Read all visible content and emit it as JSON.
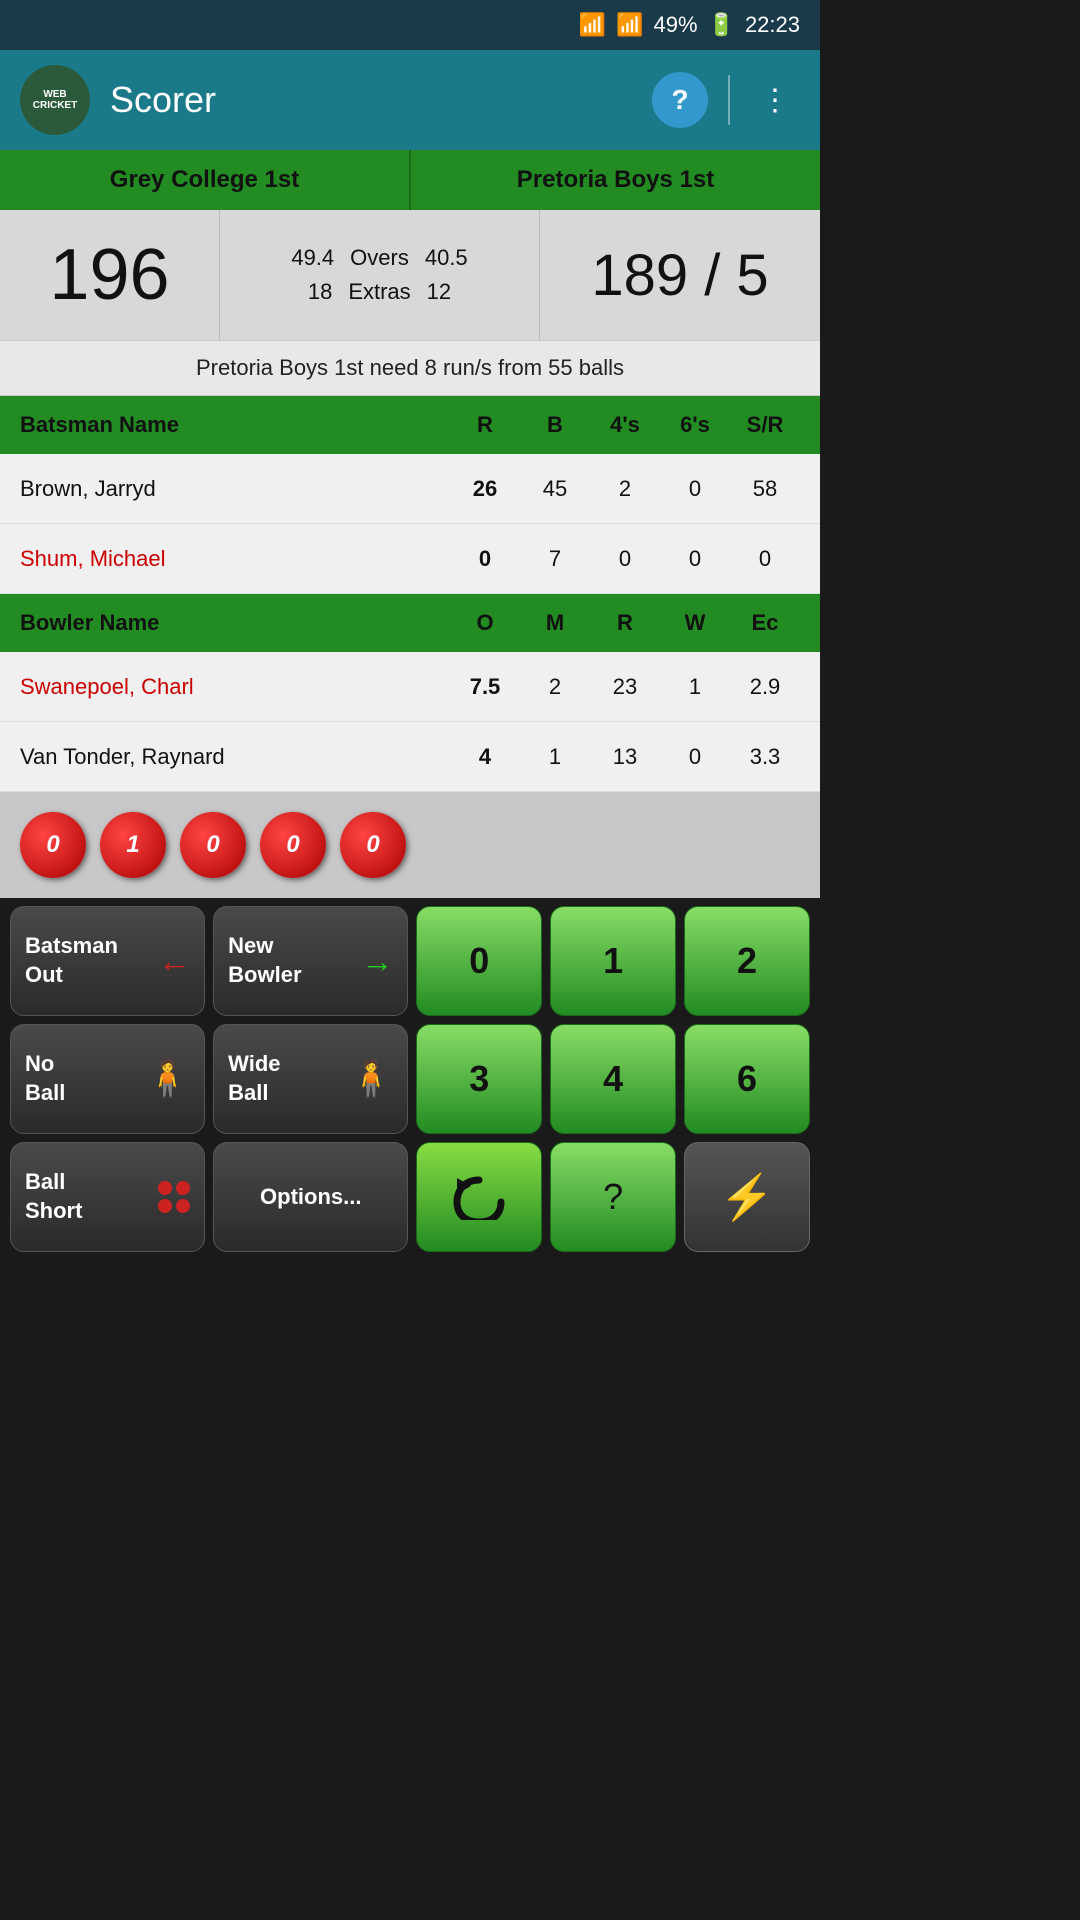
{
  "statusBar": {
    "battery": "49%",
    "time": "22:23"
  },
  "header": {
    "title": "Scorer",
    "helpLabel": "?"
  },
  "teams": {
    "team1": "Grey College 1st",
    "team2": "Pretoria Boys 1st"
  },
  "scores": {
    "team1Score": "196",
    "team1Overs": "49.4",
    "team1Extras": "18",
    "oversLabel": "Overs",
    "extrasLabel": "Extras",
    "team2Overs": "40.5",
    "team2Extras": "12",
    "team2Score": "189 / 5"
  },
  "infoBar": {
    "text": "Pretoria Boys 1st need 8 run/s from 55 balls"
  },
  "batsmanTable": {
    "headers": {
      "name": "Batsman Name",
      "r": "R",
      "b": "B",
      "fours": "4's",
      "sixes": "6's",
      "sr": "S/R"
    },
    "rows": [
      {
        "name": "Brown, Jarryd",
        "r": "26",
        "b": "45",
        "fours": "2",
        "sixes": "0",
        "sr": "58",
        "active": false
      },
      {
        "name": "Shum, Michael",
        "r": "0",
        "b": "7",
        "fours": "0",
        "sixes": "0",
        "sr": "0",
        "active": true
      }
    ]
  },
  "bowlerTable": {
    "headers": {
      "name": "Bowler Name",
      "o": "O",
      "m": "M",
      "r": "R",
      "w": "W",
      "ec": "Ec"
    },
    "rows": [
      {
        "name": "Swanepoel, Charl",
        "o": "7.5",
        "m": "2",
        "r": "23",
        "w": "1",
        "ec": "2.9",
        "active": true
      },
      {
        "name": "Van Tonder, Raynard",
        "o": "4",
        "m": "1",
        "r": "13",
        "w": "0",
        "ec": "3.3",
        "active": false
      }
    ]
  },
  "overBalls": [
    0,
    1,
    0,
    0,
    0
  ],
  "buttons": {
    "row1": {
      "batsmanOut": "Batsman\nOut",
      "newBowler": "New\nBowler",
      "run0": "0",
      "run1": "1",
      "run2": "2"
    },
    "row2": {
      "noBall": "No\nBall",
      "wideBall": "Wide\nBall",
      "run3": "3",
      "run4": "4",
      "run6": "6"
    },
    "row3": {
      "ballShort": "Ball\nShort",
      "options": "Options..."
    }
  }
}
